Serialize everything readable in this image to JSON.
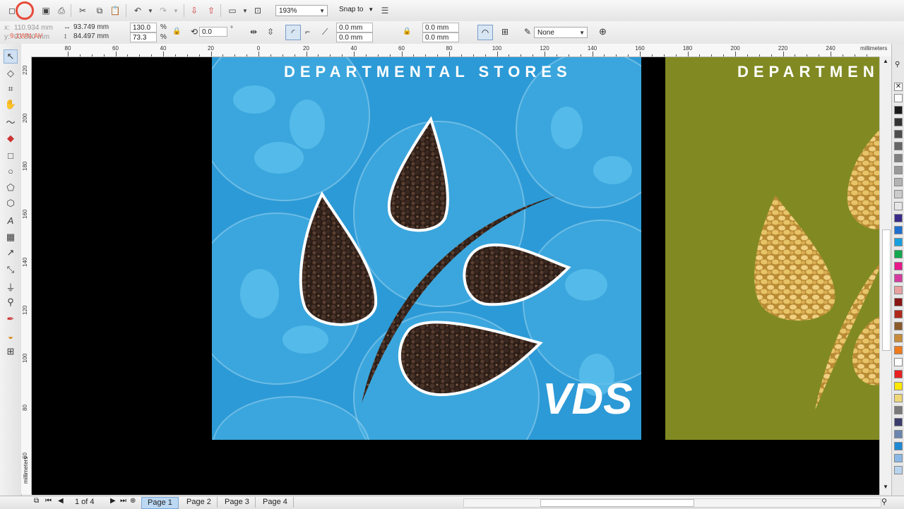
{
  "toolbar": {
    "zoom": "193%",
    "snap_to": "Snap to"
  },
  "property_bar": {
    "x_label": "x:",
    "x_value": "110.934 mm",
    "y_label": "y:",
    "y_value": "93.300 mm",
    "width": "93.749 mm",
    "height": "84.497 mm",
    "scale_w": "130.0",
    "scale_h": "73.3",
    "percent_w": "%",
    "percent_h": "%",
    "rotation": "0.0",
    "degree": "°",
    "corner_1": "0.0 mm",
    "corner_2": "0.0 mm",
    "corner_3": "0.0 mm",
    "corner_4": "0.0 mm",
    "outline": "None"
  },
  "ruler": {
    "units": "millimeters",
    "h_labels": [
      "80",
      "60",
      "40",
      "20",
      "0",
      "20",
      "40",
      "60",
      "80",
      "100",
      "120",
      "140",
      "160",
      "180",
      "200",
      "220",
      "240"
    ],
    "v_labels": [
      "220",
      "200",
      "180",
      "160",
      "140",
      "120",
      "100",
      "80",
      "60"
    ]
  },
  "page1": {
    "title": "DEPARTMENTAL STORES",
    "logo_text": "VDS"
  },
  "page2": {
    "title": "DEPARTMEN"
  },
  "watermark": "9.1WN.AV",
  "bottombar": {
    "page_count": "1 of 4",
    "pages": [
      "Page 1",
      "Page 2",
      "Page 3",
      "Page 4"
    ]
  },
  "palette_colors": [
    "#ffffff",
    "#1a1a1a",
    "#333333",
    "#4d4d4d",
    "#666666",
    "#808080",
    "#999999",
    "#b3b3b3",
    "#cccccc",
    "#e6e6e6",
    "#3a2a8a",
    "#1e6fd0",
    "#17a0e0",
    "#13a84e",
    "#e8188c",
    "#d63aa0",
    "#e9a0a0",
    "#8a1515",
    "#b0281a",
    "#8b5a2b",
    "#c98b3a",
    "#f07a1a",
    "#ffffff",
    "#e82020",
    "#ffe800",
    "#f0d878",
    "#7a7a7a",
    "#3c3c6c",
    "#6a86b0",
    "#1e8ad6",
    "#8ab8e6",
    "#b8d4ee"
  ]
}
